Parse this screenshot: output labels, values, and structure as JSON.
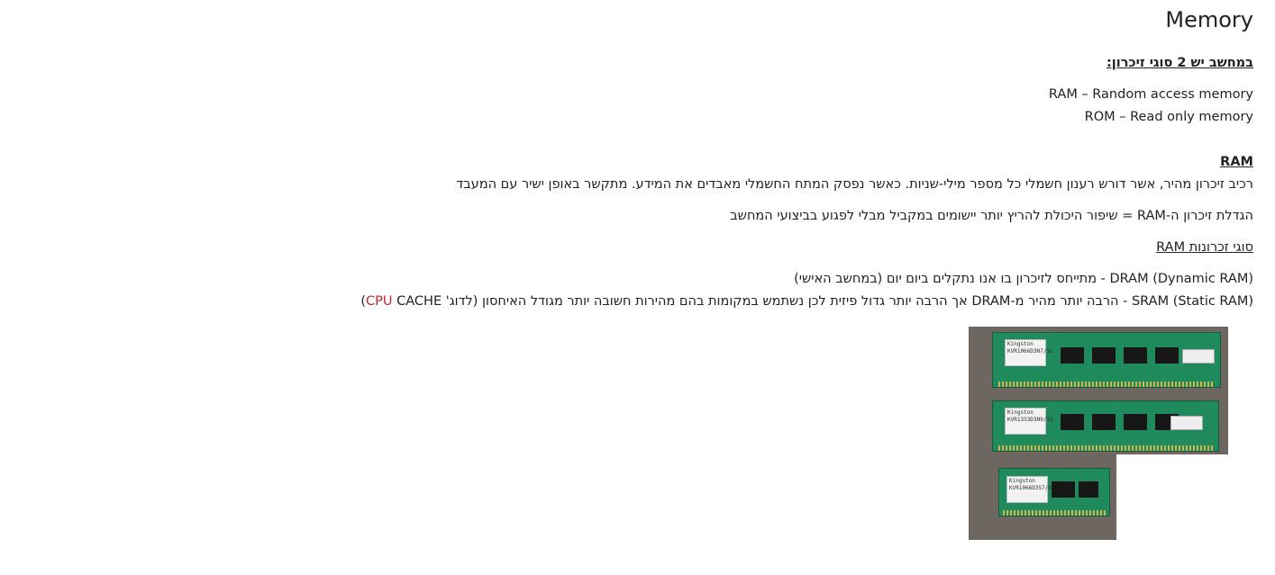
{
  "title": "Memory",
  "intro_heading": "במחשב יש 2 סוגי זיכרון:",
  "memory_types": [
    "RAM – Random access memory",
    "ROM – Read only memory"
  ],
  "ram_section": {
    "heading": "RAM",
    "description": "רכיב זיכרון מהיר, אשר דורש רענון חשמלי כל מספר מילי-שניות. כאשר נפסק המתח החשמלי מאבדים את המידע. מתקשר באופן ישיר עם המעבד",
    "upgrade_text": "הגדלת זיכרון ה-RAM = שיפור היכולת להריץ יותר יישומים במקביל מבלי לפגוע בביצועי המחשב",
    "types_heading": "סוגי זכרונות RAM",
    "dram": "DRAM (Dynamic RAM) - מתייחס לזיכרון בו אנו נתקלים ביום יום (במחשב האישי)",
    "sram_main": "SRAM (Static RAM) - הרבה יותר מהיר מ-DRAM אך הרבה יותר גדול פיזית  לכן נשתמש במקומות בהם מהירות חשובה יותר מגודל האיחסון (לדוג' ",
    "sram_highlight": "CPU",
    "sram_tail": " CACHE)"
  },
  "image": {
    "modules": [
      {
        "brand": "Kingston",
        "part": "KVR1066D3N7/1G"
      },
      {
        "brand": "Kingston",
        "part": "KVR1333D3N9/1G"
      },
      {
        "brand": "Kingston",
        "part": "KVR1066D3S7/512"
      }
    ]
  }
}
